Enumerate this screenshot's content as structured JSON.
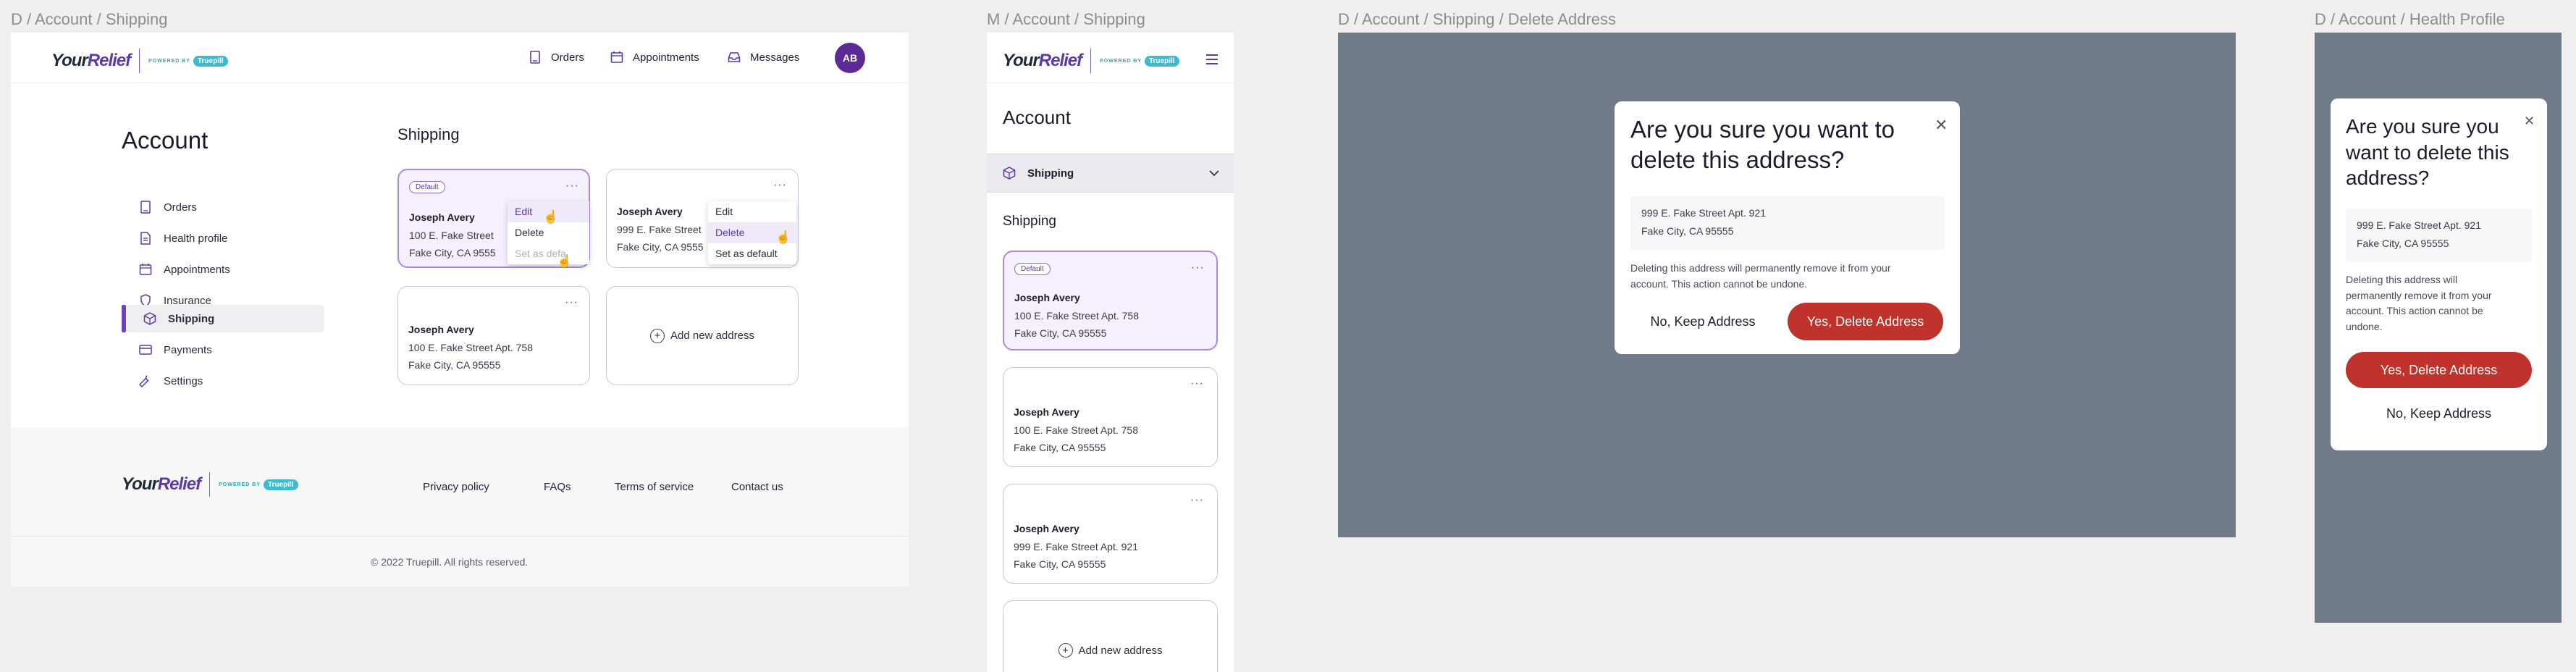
{
  "frame_labels": {
    "desktop_shipping": "D / Account / Shipping",
    "mobile_shipping": "M / Account / Shipping",
    "desktop_delete": "D / Account / Shipping / Delete Address",
    "desktop_health": "D / Account / Health Profile"
  },
  "brand": {
    "name_main": "Your",
    "name_accent": "Relief",
    "powered_by": "POWERED BY",
    "partner": "Truepill",
    "colors": {
      "primary": "#5b3aa5",
      "danger": "#c0332c",
      "overlay": "#6f7b89",
      "partner": "#3bbad0"
    }
  },
  "header": {
    "nav": [
      {
        "label": "Orders",
        "icon": "receipt-icon"
      },
      {
        "label": "Appointments",
        "icon": "calendar-icon"
      },
      {
        "label": "Messages",
        "icon": "inbox-icon"
      }
    ],
    "avatar_initials": "AB"
  },
  "account": {
    "title": "Account",
    "sidebar": [
      {
        "label": "Orders",
        "icon": "receipt-icon"
      },
      {
        "label": "Health profile",
        "icon": "document-icon"
      },
      {
        "label": "Appointments",
        "icon": "calendar-icon"
      },
      {
        "label": "Insurance",
        "icon": "shield-icon"
      },
      {
        "label": "Shipping",
        "icon": "box-icon",
        "active": true
      },
      {
        "label": "Payments",
        "icon": "credit-card-icon"
      },
      {
        "label": "Settings",
        "icon": "wrench-icon"
      }
    ]
  },
  "shipping": {
    "title": "Shipping",
    "default_badge": "Default",
    "add_new_label": "Add new address",
    "addresses": [
      {
        "name": "Joseph Avery",
        "line1": "100 E. Fake Street Apt. 758",
        "line2": "Fake City, CA 95555",
        "default": true
      },
      {
        "name": "Joseph Avery",
        "line1": "999 E. Fake Street Apt. 921",
        "line2": "Fake City, CA 95555",
        "default": false
      },
      {
        "name": "Joseph Avery",
        "line1": "100 E. Fake Street Apt. 758",
        "line2": "Fake City, CA 95555",
        "default": false
      }
    ],
    "menu_items": [
      "Edit",
      "Delete",
      "Set as default"
    ],
    "desktop_card_line1_a": "100 E. Fake Street",
    "desktop_card_line1_b": "999 E. Fake Street",
    "desktop_card_line1_c": "100 E. Fake Street Apt. 758",
    "desktop_card_line2": "Fake City, CA 9555",
    "desktop_card_line2_full": "Fake City, CA 95555",
    "set_as_default_clipped": "Set as defa"
  },
  "footer": {
    "links": [
      "Privacy policy",
      "FAQs",
      "Terms of service",
      "Contact us"
    ],
    "copyright": "© 2022 Truepill. All rights reserved."
  },
  "mobile": {
    "section_label": "Shipping",
    "section_header": "Shipping"
  },
  "delete_modal": {
    "title": "Are you sure you want to delete this address?",
    "title_line1": "Are you sure you want to",
    "title_line2": "delete this address?",
    "address_line1": "999 E. Fake Street Apt. 921",
    "address_line2": "Fake City, CA 95555",
    "warning_line1": "Deleting this address will permanently remove it from your",
    "warning_line2": "account. This action cannot be undone.",
    "keep_label": "No, Keep Address",
    "delete_label": "Yes, Delete Address"
  },
  "mobile_modal": {
    "title_line1": "Are you sure you",
    "title_line2": "want to delete this",
    "title_line3": "address?",
    "warning_lines": [
      "Deleting this address will",
      "permanently remove it from your",
      "account. This action cannot be",
      "undone."
    ]
  }
}
